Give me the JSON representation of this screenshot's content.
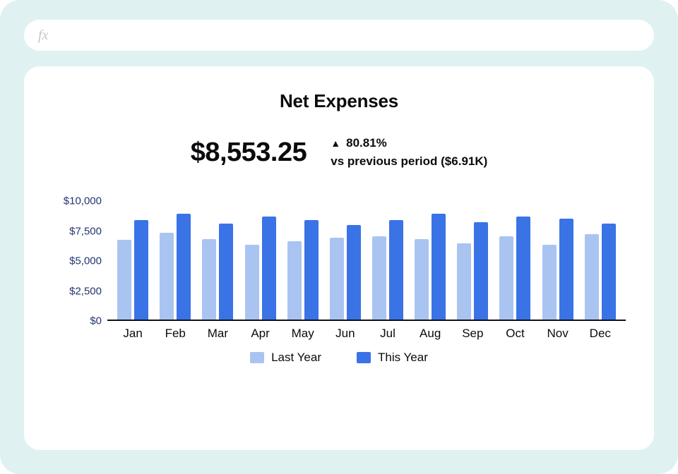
{
  "formula_bar": {
    "fx_label": "fx",
    "value": ""
  },
  "card": {
    "title": "Net Expenses",
    "kpi_value": "$8,553.25",
    "delta_symbol": "▲",
    "delta_pct": "80.81%",
    "compare_text": "vs previous period ($6.91K)"
  },
  "legend": {
    "last": "Last Year",
    "this": "This Year"
  },
  "colors": {
    "last_year": "#aac4f2",
    "this_year": "#3a73e6",
    "axis_text": "#23366f"
  },
  "chart_data": {
    "type": "bar",
    "title": "Net Expenses",
    "xlabel": "",
    "ylabel": "",
    "ylim": [
      0,
      10000
    ],
    "y_ticks": [
      0,
      2500,
      5000,
      7500,
      10000
    ],
    "y_tick_labels": [
      "$0",
      "$2,500",
      "$5,000",
      "$7,500",
      "$10,000"
    ],
    "categories": [
      "Jan",
      "Feb",
      "Mar",
      "Apr",
      "May",
      "Jun",
      "Jul",
      "Aug",
      "Sep",
      "Oct",
      "Nov",
      "Dec"
    ],
    "series": [
      {
        "name": "Last Year",
        "values": [
          6700,
          7300,
          6800,
          6300,
          6600,
          6900,
          7000,
          6800,
          6400,
          7000,
          6300,
          7200
        ]
      },
      {
        "name": "This Year",
        "values": [
          8400,
          8900,
          8100,
          8700,
          8400,
          8000,
          8400,
          8900,
          8200,
          8700,
          8500,
          8100
        ]
      }
    ],
    "legend_position": "bottom",
    "grid": false
  }
}
